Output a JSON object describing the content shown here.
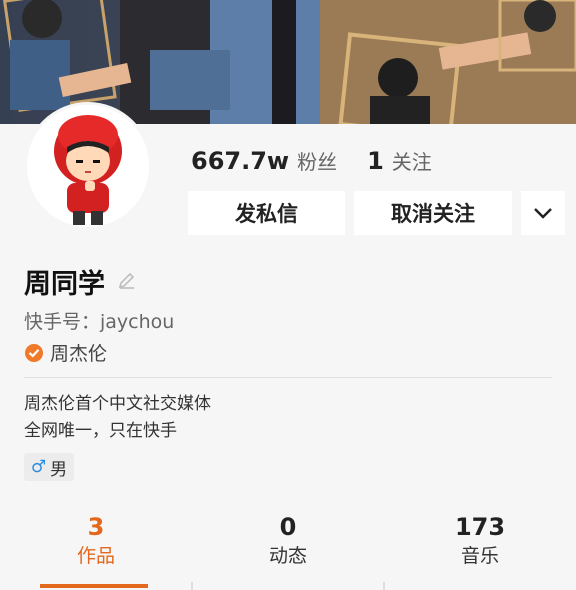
{
  "profile": {
    "stats": [
      {
        "value": "667.7w",
        "label": "粉丝"
      },
      {
        "value": "1",
        "label": "关注"
      }
    ],
    "buttons": {
      "message": "发私信",
      "unfollow": "取消关注"
    },
    "name": "周同学",
    "kuaishou_id": "快手号：jaychou",
    "verified_label": "周杰伦",
    "bio_lines": [
      "周杰伦首个中文社交媒体",
      "全网唯一，只在快手"
    ],
    "gender": {
      "sign": "♂",
      "label": "男"
    }
  },
  "tabs": [
    {
      "count": "3",
      "label": "作品",
      "active": true
    },
    {
      "count": "0",
      "label": "动态",
      "active": false
    },
    {
      "count": "173",
      "label": "音乐",
      "active": false
    }
  ],
  "colors": {
    "accent": "#e3671c",
    "gender_male": "#2a8ee0",
    "verified": "#f07a2a"
  },
  "icons": [
    "edit-icon",
    "verified-icon",
    "chevron-down-icon",
    "male-icon"
  ]
}
